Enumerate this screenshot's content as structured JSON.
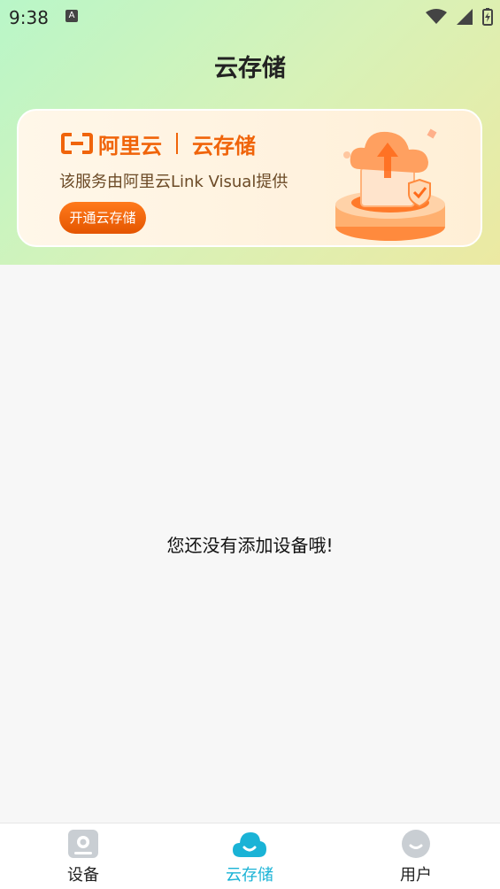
{
  "status_bar": {
    "time": "9:38",
    "notification_letter": "A"
  },
  "header": {
    "title": "云存储"
  },
  "banner": {
    "brand_name": "阿里云",
    "product_name": "云存储",
    "description": "该服务由阿里云Link Visual提供",
    "open_button": "开通云存储"
  },
  "main": {
    "empty_message": "您还没有添加设备哦!"
  },
  "bottom_nav": {
    "items": [
      {
        "label": "设备",
        "icon": "device-icon",
        "active": false
      },
      {
        "label": "云存储",
        "icon": "cloud-icon",
        "active": true
      },
      {
        "label": "用户",
        "icon": "user-icon",
        "active": false
      }
    ]
  },
  "colors": {
    "accent": "#1ab3d6",
    "brand": "#f0640a",
    "button": "#ff6a00"
  }
}
